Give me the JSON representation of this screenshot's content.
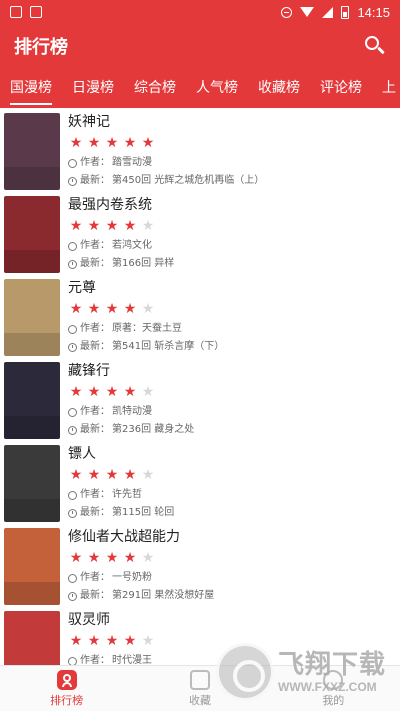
{
  "status_bar": {
    "time": "14:15"
  },
  "app_bar": {
    "title": "排行榜",
    "search_icon": "search-icon"
  },
  "tabs": [
    {
      "label": "国漫榜",
      "active": true
    },
    {
      "label": "日漫榜",
      "active": false
    },
    {
      "label": "综合榜",
      "active": false
    },
    {
      "label": "人气榜",
      "active": false
    },
    {
      "label": "收藏榜",
      "active": false
    },
    {
      "label": "评论榜",
      "active": false
    },
    {
      "label": "上",
      "active": false
    }
  ],
  "list": {
    "author_label": "作者：",
    "latest_label": "最新：",
    "items": [
      {
        "title": "妖神记",
        "rating": 5,
        "author": "踏雪动漫",
        "latest": "第450回 光辉之城危机再临（上）",
        "cover_color": "#5a3a4a"
      },
      {
        "title": "最强内卷系统",
        "rating": 4,
        "author": "若鸿文化",
        "latest": "第166回 异样",
        "cover_color": "#8a2a2e"
      },
      {
        "title": "元尊",
        "rating": 4,
        "author": "原著：天蚕土豆",
        "latest": "第541回 斩杀言摩（下）",
        "cover_color": "#b89a6a"
      },
      {
        "title": "藏锋行",
        "rating": 4,
        "author": "凯特动漫",
        "latest": "第236回 藏身之处",
        "cover_color": "#2c2a3a"
      },
      {
        "title": "镖人",
        "rating": 4,
        "author": "许先哲",
        "latest": "第115回 轮回",
        "cover_color": "#3a3a3a"
      },
      {
        "title": "修仙者大战超能力",
        "rating": 4,
        "author": "一号奶粉",
        "latest": "第291回 果然没想好屋",
        "cover_color": "#c4603a"
      },
      {
        "title": "驭灵师",
        "rating": 4,
        "author": "时代漫王",
        "latest": "",
        "cover_color": "#c23a3a"
      }
    ]
  },
  "bottom_nav": [
    {
      "label": "排行榜",
      "active": true
    },
    {
      "label": "收藏",
      "active": false
    },
    {
      "label": "我的",
      "active": false
    }
  ],
  "watermark": {
    "text": "飞翔下载",
    "url": "WWW.FXXZ.COM"
  },
  "colors": {
    "accent": "#e4393b",
    "star_off": "#d8d8d8"
  }
}
